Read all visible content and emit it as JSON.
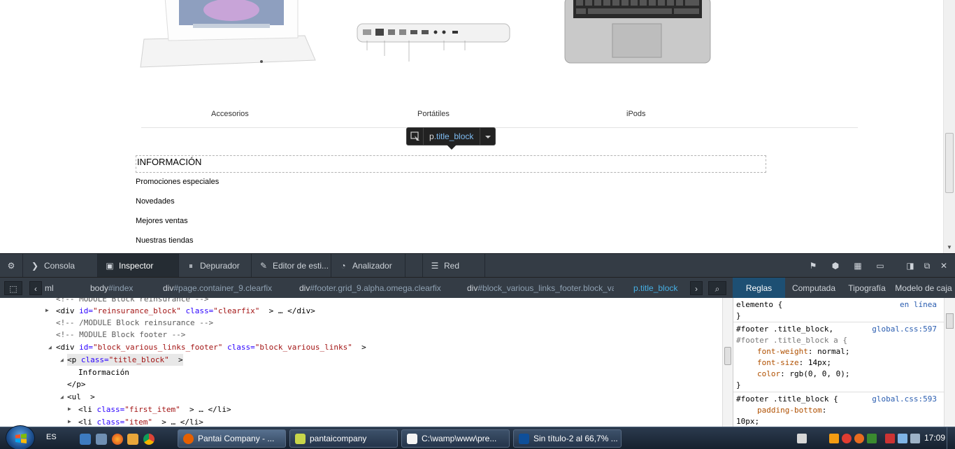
{
  "page": {
    "categories": [
      "Accesorios",
      "Portátiles",
      "iPods"
    ],
    "footer_title": "INFORMACIÓN",
    "footer_links": [
      "Promociones especiales",
      "Novedades",
      "Mejores ventas",
      "Nuestras tiendas"
    ],
    "tooltip": {
      "tag": "p",
      "class": ".title_block"
    }
  },
  "devtools": {
    "tabs": [
      {
        "label": "Consola",
        "icon": "console-icon"
      },
      {
        "label": "Inspector",
        "icon": "inspector-icon"
      },
      {
        "label": "Depurador",
        "icon": "debugger-icon"
      },
      {
        "label": "Editor de esti...",
        "icon": "style-editor-icon"
      },
      {
        "label": "Analizador",
        "icon": "profiler-icon"
      },
      {
        "label": "Red",
        "icon": "network-icon"
      }
    ],
    "active_tab": "Inspector",
    "breadcrumbs": [
      {
        "tag": "ml",
        "rest": ""
      },
      {
        "tag": "body",
        "rest": "#index"
      },
      {
        "tag": "div",
        "rest": "#page.container_9.clearfix"
      },
      {
        "tag": "div",
        "rest": "#footer.grid_9.alpha.omega.clearfix"
      },
      {
        "tag": "div",
        "rest": "#block_various_links_footer.block_va"
      },
      {
        "tag": "p",
        "rest": ".title_block"
      }
    ],
    "side_tabs": [
      "Reglas",
      "Computada",
      "Tipografía",
      "Modelo de caja"
    ],
    "active_side_tab": "Reglas",
    "markup": [
      {
        "text": "<!-- MODULE Block reinsurance -->"
      },
      {
        "open": "<div ",
        "a1": "id=",
        "v1": "\"reinsurance_block\"",
        "a2": " class=",
        "v2": "\"clearfix\"",
        "close": "  > … </div>"
      },
      {
        "text": "<!-- /MODULE Block reinsurance -->"
      },
      {
        "text": "<!-- MODULE Block footer -->"
      },
      {
        "open": "<div ",
        "a1": "id=",
        "v1": "\"block_various_links_footer\"",
        "a2": " class=",
        "v2": "\"block_various_links\"",
        "close": "  >"
      },
      {
        "open": "<p ",
        "a1": "class=",
        "v1": "\"title_block\"",
        "a2": "",
        "v2": "",
        "close": "  >"
      },
      {
        "text": "Información"
      },
      {
        "text": "</p>"
      },
      {
        "text": "<ul  >"
      },
      {
        "open": "<li ",
        "a1": "class=",
        "v1": "\"first_item\"",
        "a2": "",
        "v2": "",
        "close": "  > … </li>"
      },
      {
        "open": "<li ",
        "a1": "class=",
        "v1": "\"item\"",
        "a2": "",
        "v2": "",
        "close": "  > … </li>"
      }
    ],
    "rules": {
      "element_selector": "elemento {",
      "element_source": "en línea",
      "rule1_selector_a": "#footer .title_block,",
      "rule1_selector_b": "#footer .title_block a {",
      "rule1_source": "global.css:597",
      "rule1_props": [
        {
          "name": "font-weight",
          "value": "normal;"
        },
        {
          "name": "font-size",
          "value": "14px;"
        },
        {
          "name": "color",
          "value": "rgb(0, 0, 0);"
        }
      ],
      "rule2_selector": "#footer .title_block {",
      "rule2_source": "global.css:593",
      "rule2_props": [
        {
          "name": "padding-bottom",
          "value": ""
        }
      ],
      "rule2_wrap": "10px;",
      "close": "}"
    }
  },
  "taskbar": {
    "language": "ES",
    "tasks": [
      {
        "label": "Pantai Company - ...",
        "icon": "firefox-icon",
        "color": "#e66000"
      },
      {
        "label": "pantaicompany",
        "icon": "folder-icon",
        "color": "#8dc63f"
      },
      {
        "label": "C:\\wamp\\www\\pre...",
        "icon": "notepad-icon",
        "color": "#ffffff"
      },
      {
        "label": "Sin título-2 al 66,7% ...",
        "icon": "photoshop-icon",
        "color": "#0e4f9a"
      }
    ],
    "clock": "17:09"
  }
}
